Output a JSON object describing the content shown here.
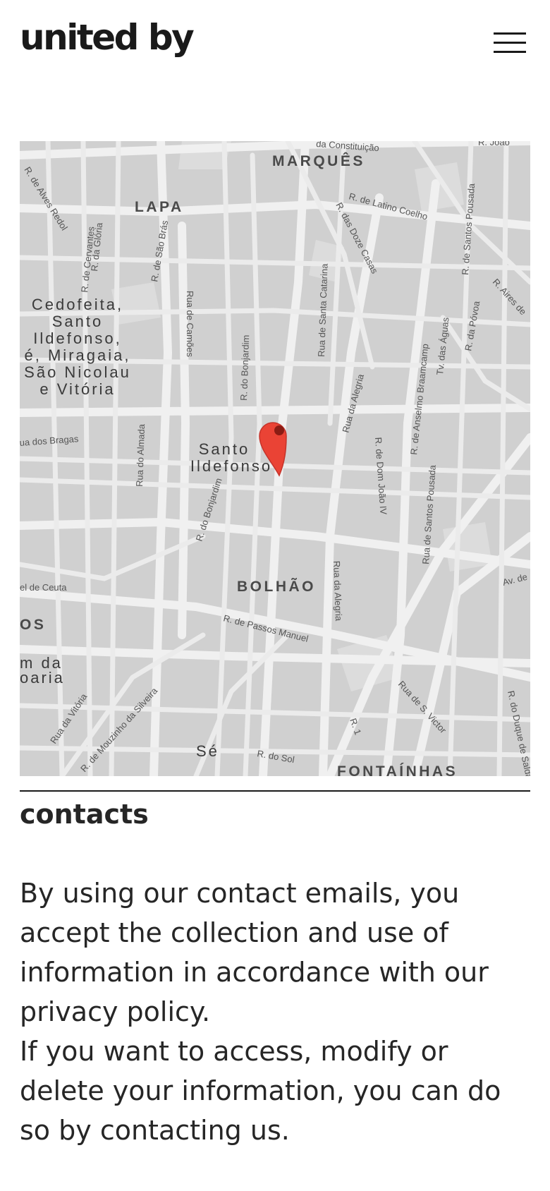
{
  "header": {
    "logo_text": "united by",
    "menu_icon": "hamburger-menu-icon"
  },
  "map": {
    "pin_icon": "map-pin-icon",
    "pin_color": "#ea4335",
    "labels": {
      "marques": "MARQUÊS",
      "lapa": "LAPA",
      "bolhao": "BOLHÃO",
      "fontainhas": "FONTAÍNHAS",
      "os": "OS",
      "cedofeita_1": "Cedofeita,",
      "cedofeita_2": "Santo",
      "cedofeita_3": "Ildefonso,",
      "cedofeita_4": "é, Miragaia,",
      "cedofeita_5": "São Nicolau",
      "cedofeita_6": "e Vitória",
      "santo": "Santo",
      "ildefonso": "Ildefonso",
      "se": "Sé",
      "mda_1": "m da",
      "mda_2": "oaria",
      "constituicao": "da Constituição",
      "joao": "R. João",
      "alves_redol": "R. de Alves Redol",
      "latino_coelho": "R. de Latino Coelho",
      "doze_casas": "R. das Doze Casas",
      "santos_pousada_top": "R. de Santos Pousada",
      "aires": "R. Aires de",
      "cervantes": "R. de Cervantes",
      "gloria": "R. da Glória",
      "sao_bras": "R. de São Brás",
      "camoes": "Rua de Camões",
      "bonjardim_top": "R. do Bonjardim",
      "santa_catarina": "Rua de Santa Catarina",
      "alegria_top": "Rua da Alegria",
      "anselmo": "R. de Anselmo Braamcamp",
      "tv_aguas": "Tv. das Águas",
      "povoa": "R. da Póvoa",
      "dos_bragas": "ua dos Bragas",
      "almada": "Rua do Almada",
      "dom_joao": "R. de Dom João IV",
      "santos_pousada_bottom": "Rua de Santos Pousada",
      "bonjardim_bottom": "R. do Bonjardim",
      "ceuta": "el de Ceuta",
      "av_de": "Av. de",
      "passos_manuel": "R. de Passos Manuel",
      "alegria_bottom": "Rua da Alegria",
      "vitoria": "Rua da Vitória",
      "mouzinho": "R. de Mouzinho da Silveira",
      "do_sol": "R. do Sol",
      "r1": "R. 1",
      "s_victor": "Rua de S. Victor",
      "duque": "R. do Duque de Saldanha"
    }
  },
  "contacts": {
    "title": "contacts",
    "paragraph_1": "By using our contact emails, you accept the collection and use of information in accordance with our privacy policy.",
    "paragraph_2": "If you want to access, modify or delete your information, you can do so by contacting us."
  }
}
